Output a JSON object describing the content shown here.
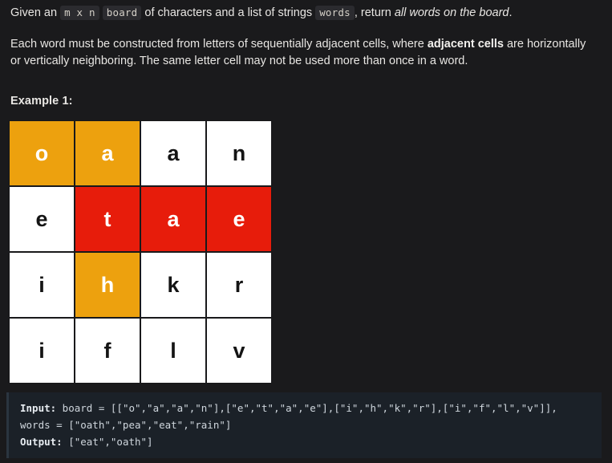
{
  "theme": {
    "background": "#1a1a1c",
    "text": "#e8e6e3",
    "inline_code_bg": "#2b2b2f",
    "code_block_bg": "#1b2128",
    "cell_white": "#ffffff",
    "cell_orange": "#eda10e",
    "cell_red": "#e71c0b",
    "cell_border": "#19191b"
  },
  "problem": {
    "paragraph1": {
      "seg_given": "Given an",
      "code_mxn": "m x n",
      "seg_board_of": "board",
      "seg_mid": "of characters and a list of strings",
      "code_words": "words",
      "seg_return": ", return",
      "em_all_words": "all words on the board",
      "seg_period": "."
    },
    "paragraph2": {
      "seg_a": "Each word must be constructed from letters of sequentially adjacent cells, where",
      "bold_adjacent": "adjacent cells",
      "seg_b": "are horizontally or vertically neighboring. The same letter cell may not be used more than once in a word."
    },
    "example_label": "Example 1:"
  },
  "board": {
    "rows": 4,
    "cols": 4,
    "cells": [
      [
        {
          "letter": "o",
          "state": "orange"
        },
        {
          "letter": "a",
          "state": "orange"
        },
        {
          "letter": "a",
          "state": "white"
        },
        {
          "letter": "n",
          "state": "white"
        }
      ],
      [
        {
          "letter": "e",
          "state": "white"
        },
        {
          "letter": "t",
          "state": "red"
        },
        {
          "letter": "a",
          "state": "red"
        },
        {
          "letter": "e",
          "state": "red"
        }
      ],
      [
        {
          "letter": "i",
          "state": "white"
        },
        {
          "letter": "h",
          "state": "orange"
        },
        {
          "letter": "k",
          "state": "white"
        },
        {
          "letter": "r",
          "state": "white"
        }
      ],
      [
        {
          "letter": "i",
          "state": "white"
        },
        {
          "letter": "f",
          "state": "white"
        },
        {
          "letter": "l",
          "state": "white"
        },
        {
          "letter": "v",
          "state": "white"
        }
      ]
    ]
  },
  "example_io": {
    "input_label": "Input:",
    "input_value": " board = [[\"o\",\"a\",\"a\",\"n\"],[\"e\",\"t\",\"a\",\"e\"],[\"i\",\"h\",\"k\",\"r\"],[\"i\",\"f\",\"l\",\"v\"]], words = [\"oath\",\"pea\",\"eat\",\"rain\"]",
    "output_label": "Output:",
    "output_value": " [\"eat\",\"oath\"]"
  }
}
